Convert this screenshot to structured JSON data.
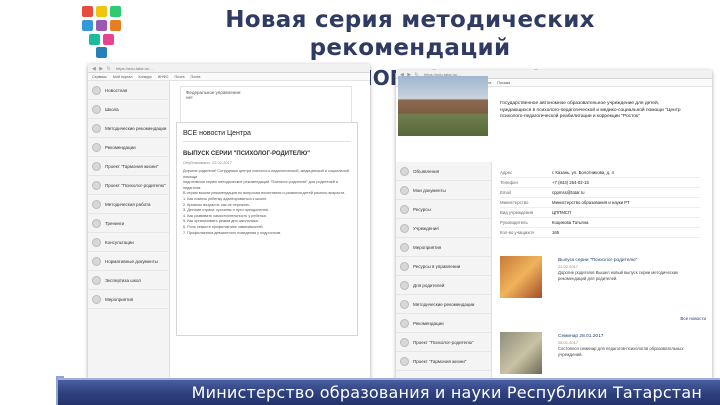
{
  "title": {
    "line1": "Новая серия методических рекомендаций",
    "line2": "\"ПСИХОЛОГ-РОДИТЕЛЮ\""
  },
  "logo_colors": [
    "#e84c3d",
    "#f1c40f",
    "#2ecc71",
    "#3498db",
    "#9b59b6",
    "#e67e22"
  ],
  "left_screenshot": {
    "url": "https://edu.tatar.ru/...",
    "bookmarks": [
      "Сервисы",
      "Мой портал",
      "Конкурс",
      "ИНФО",
      "Почта",
      "Почта"
    ],
    "info_panel": {
      "label": "Федеральное управление:",
      "value": "нет"
    },
    "sidebar": [
      "Новостная",
      "Школа",
      "Методические рекомендации",
      "Рекомендации",
      "Проект \"Гармония жизни\"",
      "Проект \"Психолог-родителю\"",
      "Методическая работа",
      "Тренинги",
      "Консультации",
      "Нормативные документы",
      "Экспертиза школ",
      "Мероприятия"
    ],
    "news": {
      "heading": "ВСЕ новости Центра",
      "title": "ВЫПУСК СЕРИИ \"ПСИХОЛОГ-РОДИТЕЛЮ\"",
      "date": "Опубликовано: 22.02.2017",
      "paragraphs": [
        "Дорогие родители! Сотрудники центра психолого-педагогической, медицинской и социальной помощи",
        "подготовили серию методических рекомендаций \"Психолог-родителю\" для родителей и педагогов.",
        "В серию вошли рекомендации по вопросам воспитания и развития детей разного возраста.",
        "1. Как помочь ребенку адаптироваться к школе.",
        "2. Кризисы возраста: как их пережить.",
        "3. Детские страхи: причины и пути преодоления.",
        "4. Как развивать самостоятельность у ребенка.",
        "5. Как организовать режим дня школьника.",
        "6. Роль семьи в профилактике зависимостей.",
        "7. Профилактика девиантного поведения у подростков."
      ]
    }
  },
  "right_screenshot": {
    "url": "https://edu.tatar.ru/...",
    "bookmarks": [
      "Сервисы",
      "Мой портал",
      "Конкурс",
      "Почта",
      "Карта",
      "Письма"
    ],
    "sidebar": [
      "Объявления",
      "Мои документы",
      "Ресурсы",
      "Учреждения",
      "Мероприятия",
      "Ресурсы в управлении",
      "Для родителей",
      "Методические рекомендации",
      "Рекомендации",
      "Проект \"Психолог-родителю\"",
      "Проект \"Гармония жизни\""
    ],
    "school_name": [
      "Государственное автономное образовательное учреждение для детей,",
      "нуждающихся в психолого-педагогической и медико-социальной помощи \"Центр",
      "психолого-педагогической реабилитации и коррекции \"Росток\""
    ],
    "details": [
      {
        "k": "Адрес",
        "v": "г. Казань, ул. Болотникова, д. 4"
      },
      {
        "k": "Телефон",
        "v": "+7 (843) 254-02-15"
      },
      {
        "k": "Email",
        "v": "cppmss@tatar.ru"
      },
      {
        "k": "Министерство",
        "v": "Министерство образования и науки РТ"
      },
      {
        "k": "Вид учреждения",
        "v": "ЦППМСП"
      },
      {
        "k": "Руководитель",
        "v": "Коцинова Татьяна"
      },
      {
        "k": "Кол-во учащихся",
        "v": "165"
      }
    ],
    "news": [
      {
        "title": "Выпуск серии \"Психолог-родителю\"",
        "date": "22.02.2017",
        "text": "Дорогие родители! Вышел новый выпуск серии методических рекомендаций для родителей."
      },
      {
        "title": "Семинар 28.01.2017",
        "date": "28.01.2017",
        "text": "Состоялся семинар для педагогов-психологов образовательных учреждений."
      }
    ],
    "more_label": "Все новости"
  },
  "footer": "Министерство образования и науки Республики Татарстан"
}
